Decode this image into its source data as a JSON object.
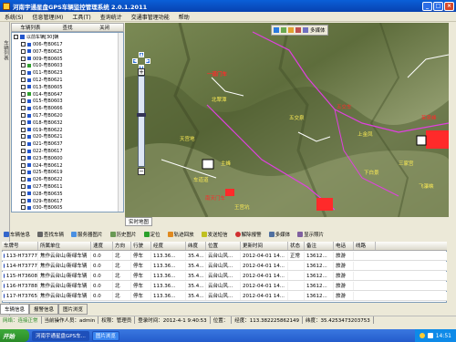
{
  "window": {
    "title": "河南宇通星盘GPS车辆监控管理系统 2.0.1.2011"
  },
  "menu": [
    "系统(S)",
    "信息管理(M)",
    "工具(T)",
    "查询统计",
    "交通事管理功能",
    "帮助"
  ],
  "left_strip": {
    "label": "车辆列表"
  },
  "vehicle_panel": {
    "header": [
      "车辆列表",
      "查找",
      "关闭"
    ],
    "group_label": "以前车辆[30]辆",
    "vehicles": [
      {
        "id": "006-粤B0617",
        "color": "#2255cc"
      },
      {
        "id": "007-粤B0625",
        "color": "#2255cc"
      },
      {
        "id": "009-粤B0605",
        "color": "#2255cc"
      },
      {
        "id": "010-粤B0603",
        "color": "#2ea02e"
      },
      {
        "id": "011-粤B0623",
        "color": "#2255cc"
      },
      {
        "id": "012-粤B0621",
        "color": "#2255cc"
      },
      {
        "id": "013-粤B0605",
        "color": "#2255cc"
      },
      {
        "id": "014-粤B0647",
        "color": "#2ea02e"
      },
      {
        "id": "015-粤B0603",
        "color": "#2255cc"
      },
      {
        "id": "016-粤B0666",
        "color": "#2255cc"
      },
      {
        "id": "017-粤B0620",
        "color": "#2255cc"
      },
      {
        "id": "018-粤B0632",
        "color": "#2255cc"
      },
      {
        "id": "019-粤B0622",
        "color": "#2255cc"
      },
      {
        "id": "020-粤B0621",
        "color": "#2255cc"
      },
      {
        "id": "021-粤B0637",
        "color": "#2255cc"
      },
      {
        "id": "022-粤B0617",
        "color": "#2255cc"
      },
      {
        "id": "023-粤B0600",
        "color": "#2255cc"
      },
      {
        "id": "024-粤B0612",
        "color": "#2255cc"
      },
      {
        "id": "025-粤B0619",
        "color": "#2255cc"
      },
      {
        "id": "026-粤B0622",
        "color": "#2255cc"
      },
      {
        "id": "027-粤B0611",
        "color": "#2255cc"
      },
      {
        "id": "028-粤B0635",
        "color": "#2255cc"
      },
      {
        "id": "029-粤B0617",
        "color": "#2255cc"
      },
      {
        "id": "030-粤B0605",
        "color": "#2255cc"
      }
    ]
  },
  "map": {
    "toolbar_label": "多媒体",
    "realtime_tab": "实时地图",
    "labels": [
      {
        "text": "一道门车",
        "color": "#ff2a2a"
      },
      {
        "text": "北翠潭",
        "color": "#ffee55"
      },
      {
        "text": "五交车",
        "color": "#ff2a2a"
      },
      {
        "text": "上金凤",
        "color": "#ffee55"
      },
      {
        "text": "茱萸峰",
        "color": "#ff2a2a"
      },
      {
        "text": "五交泉",
        "color": "#ffee55"
      },
      {
        "text": "天宫地",
        "color": "#ffee55"
      },
      {
        "text": "主峰",
        "color": "#ffee55"
      },
      {
        "text": "下白景",
        "color": "#ffee55"
      },
      {
        "text": "三家宫",
        "color": "#ffee55"
      },
      {
        "text": "车道道",
        "color": "#ffee55"
      },
      {
        "text": "南天门车",
        "color": "#ff2a2a"
      },
      {
        "text": "王宫坑",
        "color": "#ffee55"
      },
      {
        "text": "飞瀑峡",
        "color": "#ffee55"
      }
    ]
  },
  "toolbar": [
    {
      "label": "车辆信息",
      "icon": "car-icon"
    },
    {
      "label": "查找车辆",
      "icon": "search-icon"
    },
    {
      "label": "服务器图片",
      "icon": "picture-icon"
    },
    {
      "label": "历史图片",
      "icon": "history-icon"
    },
    {
      "label": "定位",
      "icon": "locate-icon"
    },
    {
      "label": "轨迹回放",
      "icon": "replay-icon"
    },
    {
      "label": "发送短信",
      "icon": "message-icon"
    },
    {
      "label": "解除报警",
      "icon": "alarm-icon"
    },
    {
      "label": "多媒体",
      "icon": "media-icon"
    },
    {
      "label": "显示照片",
      "icon": "photo-icon"
    }
  ],
  "table": {
    "columns": [
      "车牌号",
      "所属单位",
      "速度",
      "方向",
      "行驶",
      "经度",
      "纬度",
      "位置",
      "更新时间",
      "状态",
      "备注",
      "电话",
      "线路"
    ],
    "rows": [
      [
        "113-H73777",
        "焦作云台山/新绿车辆",
        "0.0",
        "北",
        "停车",
        "113.36...",
        "35.4...",
        "云台山风...",
        "2012-04-01 14...",
        "正常",
        "13612...",
        "旅游"
      ],
      [
        "114-H73777",
        "焦作云台山/新绿车辆",
        "0.0",
        "北",
        "停车",
        "113.36...",
        "35.4...",
        "云台山风...",
        "2012-04-01 14...",
        "",
        "13612...",
        "旅游"
      ],
      [
        "115-H73608",
        "焦作云台山/新绿车辆",
        "0.0",
        "北",
        "停车",
        "113.36...",
        "35.4...",
        "云台山风...",
        "2012-04-01 14...",
        "",
        "13612...",
        "旅游"
      ],
      [
        "116-H73788",
        "焦作云台山/新绿车辆",
        "0.0",
        "北",
        "停车",
        "113.36...",
        "35.4...",
        "云台山风...",
        "2012-04-01 14...",
        "",
        "13612...",
        "旅游"
      ],
      [
        "117-H73765",
        "焦作云台山/新绿车辆",
        "0.0",
        "北",
        "停车",
        "113.36...",
        "35.4...",
        "云台山风...",
        "2012-04-01 14...",
        "",
        "13612...",
        "旅游"
      ]
    ]
  },
  "bottom_tabs": [
    "车辆信息",
    "报警信息",
    "图片浏览"
  ],
  "status": {
    "connection": "网络：连接正常",
    "operator": "当前操作人员：admin",
    "permission": "权限：管理员",
    "login_time": "登录时间：2012-4-1 9:40:53",
    "position": "位置：",
    "longitude": "经度：113.382225862149",
    "latitude": "纬度：35.4253473203753"
  },
  "taskbar": {
    "start": "开始",
    "tasks": [
      "河南宇通星盘GPS车...",
      "图片浏览"
    ],
    "clock": "14:51"
  }
}
